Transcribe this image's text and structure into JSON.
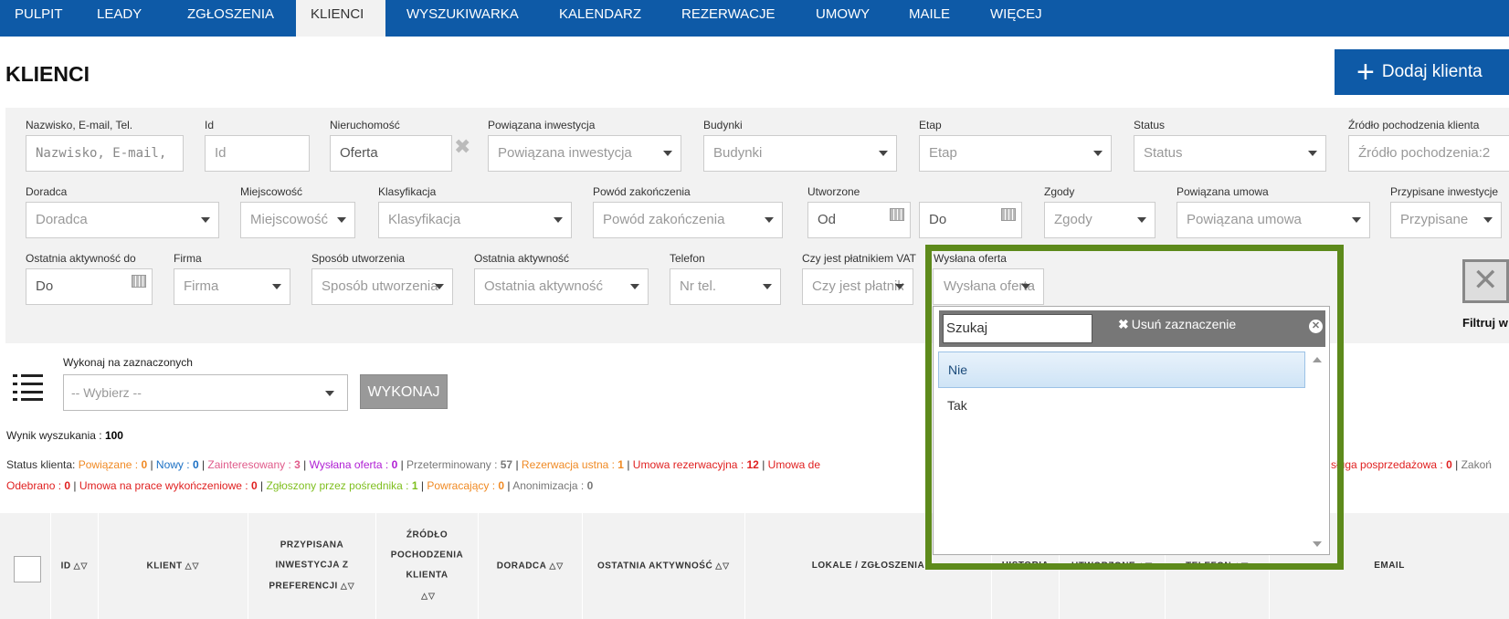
{
  "nav": {
    "items": [
      "PULPIT",
      "LEADY",
      "ZGŁOSZENIA",
      "KLIENCI",
      "WYSZUKIWARKA",
      "KALENDARZ",
      "REZERWACJE",
      "UMOWY",
      "MAILE",
      "WIĘCEJ"
    ],
    "active": "KLIENCI"
  },
  "page": {
    "title": "KLIENCI",
    "add_button": "Dodaj klienta"
  },
  "filters": {
    "row1": [
      {
        "label": "Nazwisko, E-mail, Tel.",
        "placeholder": "Nazwisko, E-mail, Tel."
      },
      {
        "label": "Id",
        "placeholder": "Id"
      },
      {
        "label": "Nieruchomość",
        "value": "Oferta"
      },
      {
        "label": "Powiązana inwestycja",
        "placeholder": "Powiązana inwestycja"
      },
      {
        "label": "Budynki",
        "placeholder": "Budynki"
      },
      {
        "label": "Etap",
        "placeholder": "Etap"
      },
      {
        "label": "Status",
        "placeholder": "Status"
      },
      {
        "label": "Źródło pochodzenia klienta",
        "value": "Źródło pochodzenia:2"
      }
    ],
    "row2": [
      {
        "label": "Doradca",
        "placeholder": "Doradca"
      },
      {
        "label": "Miejscowość",
        "placeholder": "Miejscowość"
      },
      {
        "label": "Klasyfikacja",
        "placeholder": "Klasyfikacja"
      },
      {
        "label": "Powód zakończenia",
        "placeholder": "Powód zakończenia"
      },
      {
        "label": "Utworzone",
        "placeholder_from": "Od",
        "placeholder_to": "Do"
      },
      {
        "label": "Zgody",
        "placeholder": "Zgody"
      },
      {
        "label": "Powiązana umowa",
        "placeholder": "Powiązana umowa"
      },
      {
        "label": "Przypisane inwestycje",
        "placeholder": "Przypisane"
      }
    ],
    "row3": [
      {
        "label": "Ostatnia aktywność do",
        "placeholder": "Do"
      },
      {
        "label": "Firma",
        "placeholder": "Firma"
      },
      {
        "label": "Sposób utworzenia",
        "placeholder": "Sposób utworzenia"
      },
      {
        "label": "Ostatnia aktywność",
        "placeholder": "Ostatnia aktywność"
      },
      {
        "label": "Telefon",
        "placeholder": "Nr tel."
      },
      {
        "label": "Czy jest płatnikiem VAT",
        "placeholder": "Czy jest płatnikiem VAT"
      }
    ],
    "filter_button": "Filtruj w"
  },
  "dropdown": {
    "label": "Wysłana oferta",
    "placeholder": "Wysłana oferta",
    "search_placeholder": "Szukaj",
    "clear_label": "Usuń zaznaczenie",
    "options": [
      {
        "label": "Nie",
        "selected": true
      },
      {
        "label": "Tak",
        "selected": false
      }
    ]
  },
  "bulk": {
    "label": "Wykonaj na zaznaczonych",
    "placeholder": "-- Wybierz --",
    "button": "WYKONAJ"
  },
  "results": {
    "label": "Wynik wyszukania :",
    "count": "100"
  },
  "status": {
    "prefix": "Status klienta:",
    "line1": [
      {
        "label": "Powiązane",
        "count": "0",
        "color": "#f08a24"
      },
      {
        "label": "Nowy",
        "count": "0",
        "color": "#1a6fc4"
      },
      {
        "label": "Zainteresowany",
        "count": "3",
        "color": "#e05a8a"
      },
      {
        "label": "Wysłana oferta",
        "count": "0",
        "color": "#b01fd4"
      },
      {
        "label": "Przeterminowany",
        "count": "57",
        "color": "#777777"
      },
      {
        "label": "Rezerwacja ustna",
        "count": "1",
        "color": "#f08a24"
      },
      {
        "label": "Umowa rezerwacyjna",
        "count": "12",
        "color": "#e02020"
      },
      {
        "label": "Umowa de",
        "count": "",
        "color": "#e02020"
      }
    ],
    "line1_tail": [
      {
        "label": "sługa posprzedażowa",
        "count": "0",
        "color": "#e02020"
      },
      {
        "label": "Zakoń",
        "count": "",
        "color": "#777777"
      }
    ],
    "line2": [
      {
        "label": "Odebrano",
        "count": "0",
        "color": "#e02020"
      },
      {
        "label": "Umowa na prace wykończeniowe",
        "count": "0",
        "color": "#e02020"
      },
      {
        "label": "Zgłoszony przez pośrednika",
        "count": "1",
        "color": "#7fbf1f"
      },
      {
        "label": "Powracający",
        "count": "0",
        "color": "#f08a24"
      },
      {
        "label": "Anonimizacja",
        "count": "0",
        "color": "#777777"
      }
    ]
  },
  "table": {
    "columns": [
      "ID",
      "KLIENT",
      "PRZYPISANA INWESTYCJA Z PREFERENCJI",
      "ŹRÓDŁO POCHODZENIA KLIENTA",
      "DORADCA",
      "OSTATNIA AKTYWNOŚĆ",
      "LOKALE / ZGŁOSZENIA",
      "HISTORIA",
      "UTWORZONE",
      "TELEFON",
      "EMAIL"
    ]
  },
  "icons": {
    "add": "plus-icon",
    "calendar": "calendar-icon",
    "list": "list-icon",
    "filter": "filter-clear-icon"
  },
  "colors": {
    "brand": "#0e5aa7",
    "highlight": "#5d8a1b"
  }
}
